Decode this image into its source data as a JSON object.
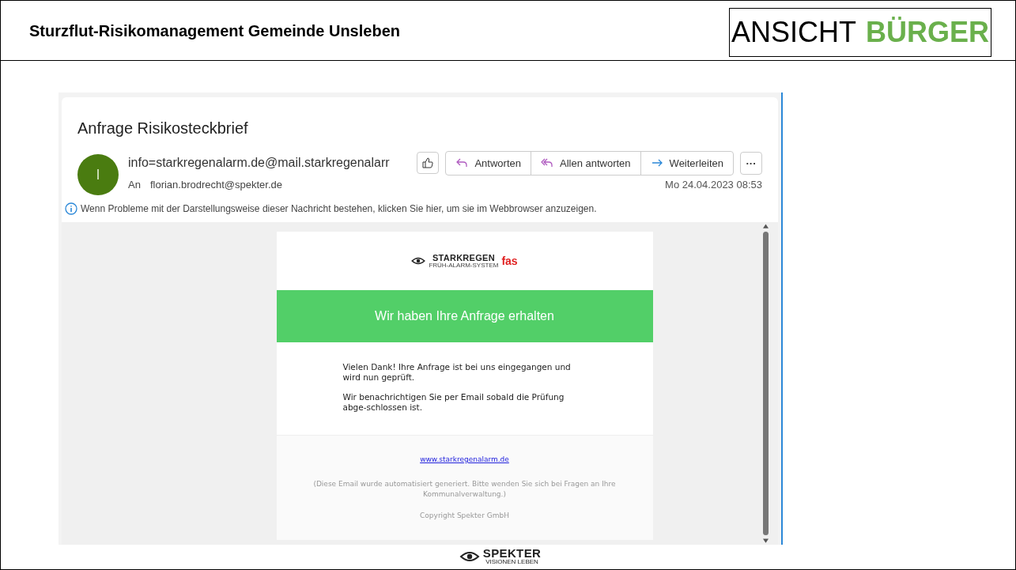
{
  "slide": {
    "title": "Sturzflut-Risikomanagement Gemeinde Unsleben",
    "view_label": {
      "prefix": "ANSICHT",
      "highlight": "BÜRGER"
    }
  },
  "email": {
    "subject": "Anfrage Risikosteckbrief",
    "avatar_initial": "I",
    "sender": "info=starkregenalarm.de@mail.starkregenalarr",
    "to_label": "An",
    "recipient": "florian.brodrecht@spekter.de",
    "date": "Mo 24.04.2023 08:53",
    "actions": [
      {
        "kind": "reply",
        "label": "Antworten"
      },
      {
        "kind": "reply_all",
        "label": "Allen antworten"
      },
      {
        "kind": "forward",
        "label": "Weiterleiten"
      }
    ],
    "more": "···",
    "info": "Wenn Probleme mit der Darstellungsweise dieser Nachricht bestehen, klicken Sie hier, um sie im Webbrowser anzuzeigen.",
    "body": {
      "logo": {
        "word": "STARKREGEN",
        "suffix": "fas",
        "tagline": "FRÜH-ALARM-SYSTEM"
      },
      "banner": "Wir haben Ihre Anfrage erhalten",
      "paragraphs": [
        "Vielen Dank! Ihre Anfrage ist bei uns eingegangen und wird nun geprüft.",
        "Wir benachrichtigen Sie per Email sobald die Prüfung abge-schlossen ist."
      ],
      "link": "www.starkregenalarm.de",
      "note": "(Diese Email wurde automatisiert generiert. Bitte wenden Sie sich bei Fragen an Ihre Kommunalverwaltung.)",
      "copyright": "Copyright Spekter GmbH"
    }
  },
  "footer_logo": {
    "name": "SPEKTER",
    "tagline": "VISIONEN LEBEN"
  }
}
